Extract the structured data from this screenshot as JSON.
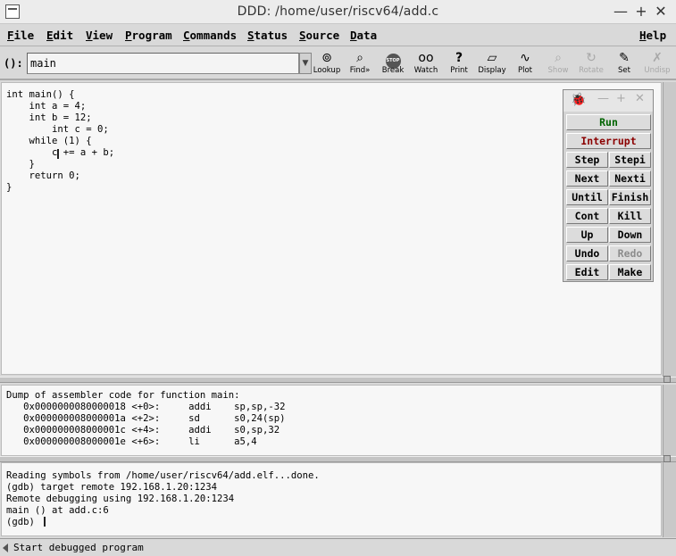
{
  "window": {
    "title": "DDD: /home/user/riscv64/add.c",
    "buttons": [
      "—",
      "+",
      "✕"
    ]
  },
  "menubar": {
    "items": [
      {
        "key": "F",
        "rest": "ile"
      },
      {
        "key": "E",
        "rest": "dit"
      },
      {
        "key": "V",
        "rest": "iew"
      },
      {
        "key": "P",
        "rest": "rogram"
      },
      {
        "key": "C",
        "rest": "ommands"
      },
      {
        "key": "S",
        "rest": "tatus"
      },
      {
        "key": "S",
        "rest": "ource"
      },
      {
        "key": "D",
        "rest": "ata"
      }
    ],
    "help": {
      "key": "H",
      "rest": "elp"
    }
  },
  "toolbar": {
    "arg_label": "():",
    "arg_value": "main",
    "buttons": [
      {
        "label": "Lookup",
        "icon": "lookup-icon",
        "glyph": "⊚",
        "enabled": true
      },
      {
        "label": "Find»",
        "icon": "find-icon",
        "glyph": "⌕",
        "enabled": true
      },
      {
        "label": "Break",
        "icon": "stop-sign-icon",
        "glyph": "STOP",
        "enabled": true
      },
      {
        "label": "Watch",
        "icon": "glasses-icon",
        "glyph": "oo",
        "enabled": true
      },
      {
        "label": "Print",
        "icon": "question-icon",
        "glyph": "?",
        "enabled": true
      },
      {
        "label": "Display",
        "icon": "display-icon",
        "glyph": "▱",
        "enabled": true
      },
      {
        "label": "Plot",
        "icon": "plot-icon",
        "glyph": "∿",
        "enabled": true
      },
      {
        "label": "Show",
        "icon": "magnifier-icon",
        "glyph": "⌕",
        "enabled": false
      },
      {
        "label": "Rotate",
        "icon": "rotate-icon",
        "glyph": "↻",
        "enabled": false
      },
      {
        "label": "Set",
        "icon": "set-icon",
        "glyph": "✎",
        "enabled": true
      },
      {
        "label": "Undisp",
        "icon": "undisp-icon",
        "glyph": "✗",
        "enabled": false
      }
    ]
  },
  "source": {
    "code": "int main() {\n    int a = 4;\n    int b = 12;\n        int c = 0;\n    while (1) {\n        c += a + b;\n    }\n    return 0;\n}"
  },
  "assembler": {
    "text": "Dump of assembler code for function main:\n   0x0000000080000018 <+0>:     addi    sp,sp,-32\n   0x000000008000001a <+2>:     sd      s0,24(sp)\n   0x000000008000001c <+4>:     addi    s0,sp,32\n   0x000000008000001e <+6>:     li      a5,4"
  },
  "console": {
    "text": "Reading symbols from /home/user/riscv64/add.elf...done.\n(gdb) target remote 192.168.1.20:1234\nRemote debugging using 192.168.1.20:1234\nmain () at add.c:6\n(gdb) "
  },
  "status": {
    "text": "Start debugged program"
  },
  "command_tool": {
    "run": "Run",
    "interrupt": "Interrupt",
    "rows": [
      [
        "Step",
        "Stepi"
      ],
      [
        "Next",
        "Nexti"
      ],
      [
        "Until",
        "Finish"
      ],
      [
        "Cont",
        "Kill"
      ],
      [
        "Up",
        "Down"
      ],
      [
        "Undo",
        "Redo"
      ],
      [
        "Edit",
        "Make"
      ]
    ],
    "colors": {
      "run": "#006400",
      "interrupt": "#8b0000",
      "disabled": "#8c8c8c"
    }
  }
}
